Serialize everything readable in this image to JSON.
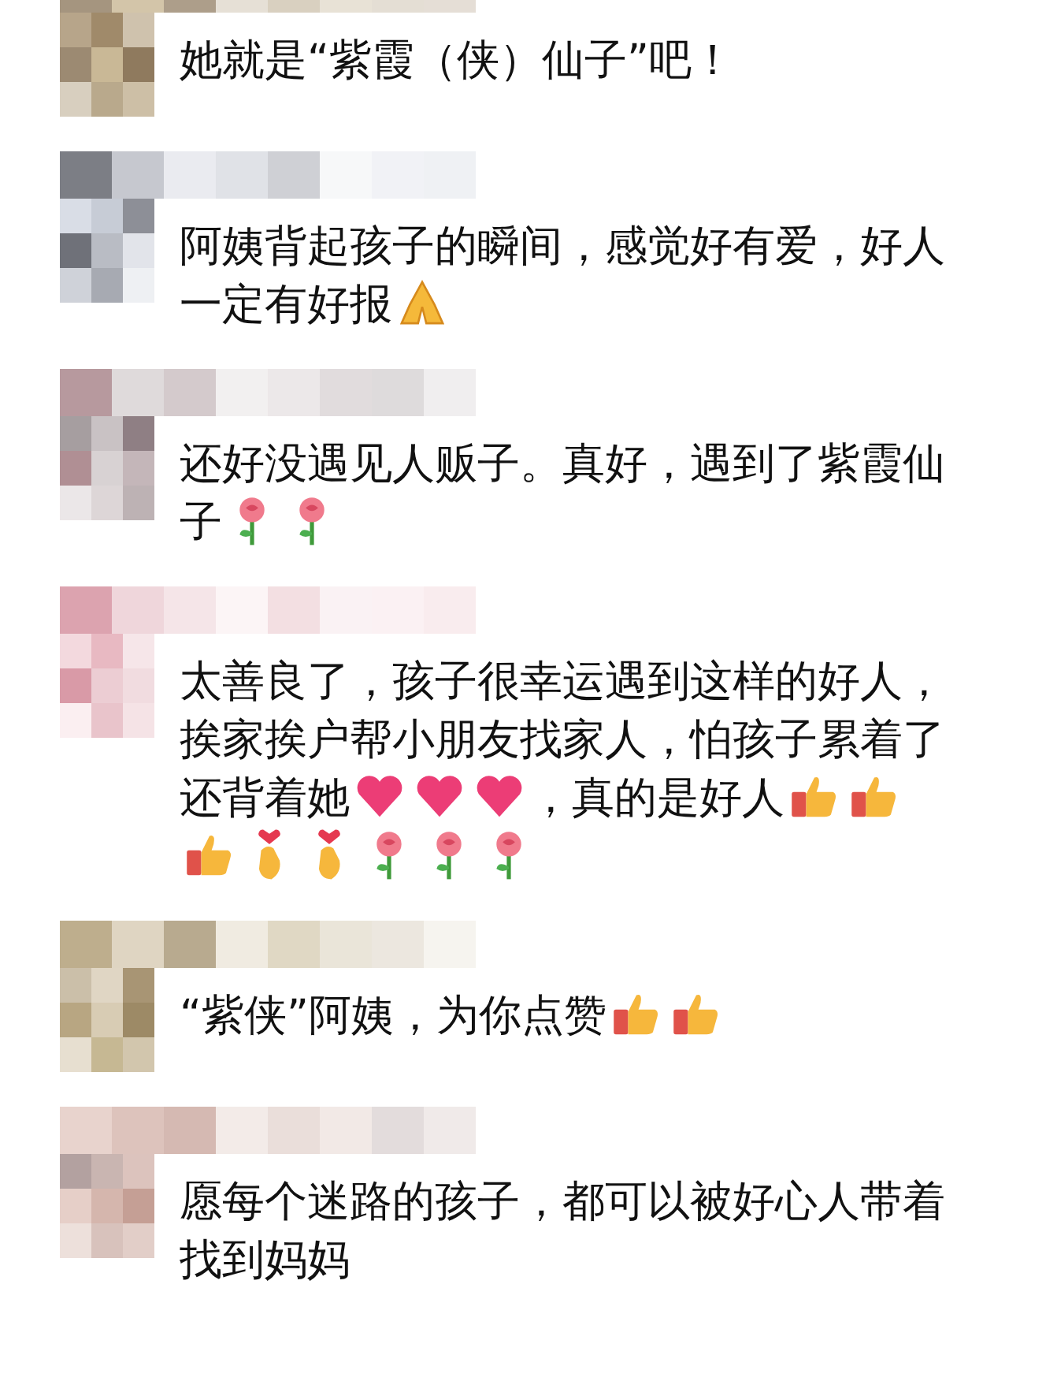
{
  "comments": [
    {
      "parts": [
        {
          "kind": "text",
          "text": "她就是“紫霞（侠）仙子”吧！"
        }
      ]
    },
    {
      "parts": [
        {
          "kind": "text",
          "text": "阿姨背起孩子的瞬间，感觉好有爱，好人"
        },
        {
          "kind": "text",
          "text": "一定有好报"
        },
        {
          "kind": "pray"
        }
      ]
    },
    {
      "parts": [
        {
          "kind": "text",
          "text": "还好没遇见人贩子。真好，遇到了紫霞仙"
        },
        {
          "kind": "text",
          "text": "子"
        },
        {
          "kind": "rose"
        },
        {
          "kind": "rose"
        }
      ]
    },
    {
      "parts": [
        {
          "kind": "text",
          "text": "太善良了，孩子很幸运遇到这样的好人，"
        },
        {
          "kind": "text",
          "text": "挨家挨户帮小朋友找家人，怕孩子累着了"
        },
        {
          "kind": "text",
          "text": "还背着她"
        },
        {
          "kind": "heart"
        },
        {
          "kind": "heart"
        },
        {
          "kind": "heart"
        },
        {
          "kind": "text",
          "text": "，真的是好人"
        },
        {
          "kind": "thumb"
        },
        {
          "kind": "thumb"
        },
        {
          "kind": "thumb"
        },
        {
          "kind": "fingerheart"
        },
        {
          "kind": "fingerheart"
        },
        {
          "kind": "rose"
        },
        {
          "kind": "rose"
        },
        {
          "kind": "rose"
        }
      ]
    },
    {
      "parts": [
        {
          "kind": "text",
          "text": "“紫侠”阿姨，为你点赞"
        },
        {
          "kind": "thumb"
        },
        {
          "kind": "thumb"
        }
      ]
    },
    {
      "parts": [
        {
          "kind": "text",
          "text": "愿每个迷路的孩子，都可以被好心人带着"
        },
        {
          "kind": "text",
          "text": "找到妈妈"
        }
      ]
    }
  ]
}
